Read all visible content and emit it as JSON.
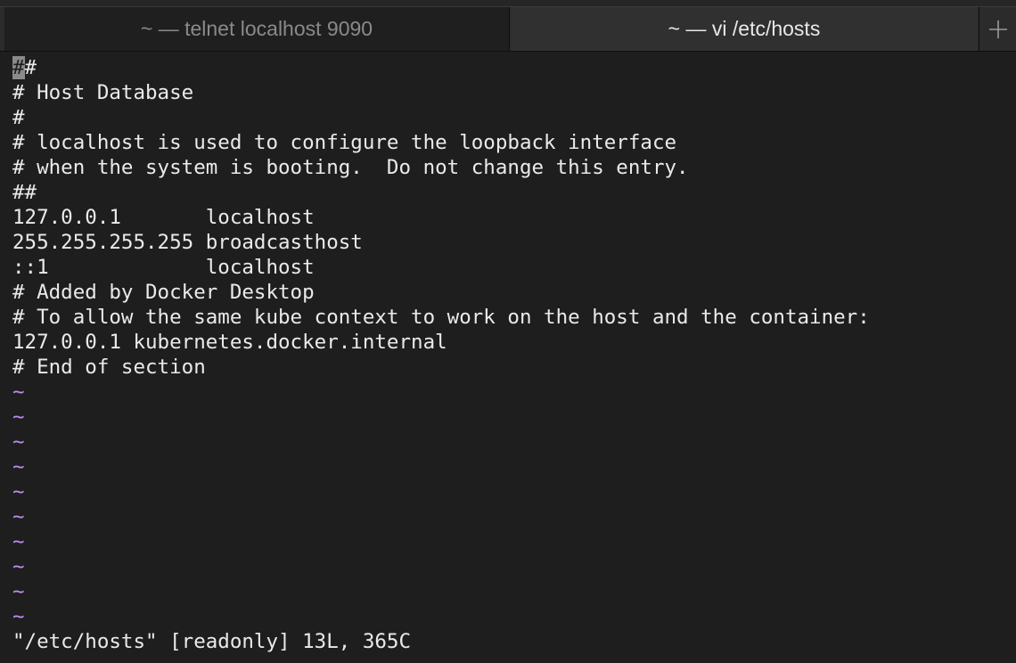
{
  "tabs": [
    {
      "label": "~ — telnet localhost 9090",
      "active": false
    },
    {
      "label": "~ — vi /etc/hosts",
      "active": true
    }
  ],
  "new_tab_icon": "plus-icon",
  "editor": {
    "cursor_char": "#",
    "first_line_rest": "#",
    "lines": [
      "# Host Database",
      "#",
      "# localhost is used to configure the loopback interface",
      "# when the system is booting.  Do not change this entry.",
      "##",
      "127.0.0.1       localhost",
      "255.255.255.255 broadcasthost",
      "::1             localhost",
      "# Added by Docker Desktop",
      "# To allow the same kube context to work on the host and the container:",
      "127.0.0.1 kubernetes.docker.internal",
      "# End of section"
    ],
    "tilde": "~",
    "status": "\"/etc/hosts\" [readonly] 13L, 365C"
  },
  "colors": {
    "background": "#1e1e1e",
    "text": "#eaeaea",
    "tilde": "#c08cf0",
    "cursor": "#8a8a8a"
  }
}
